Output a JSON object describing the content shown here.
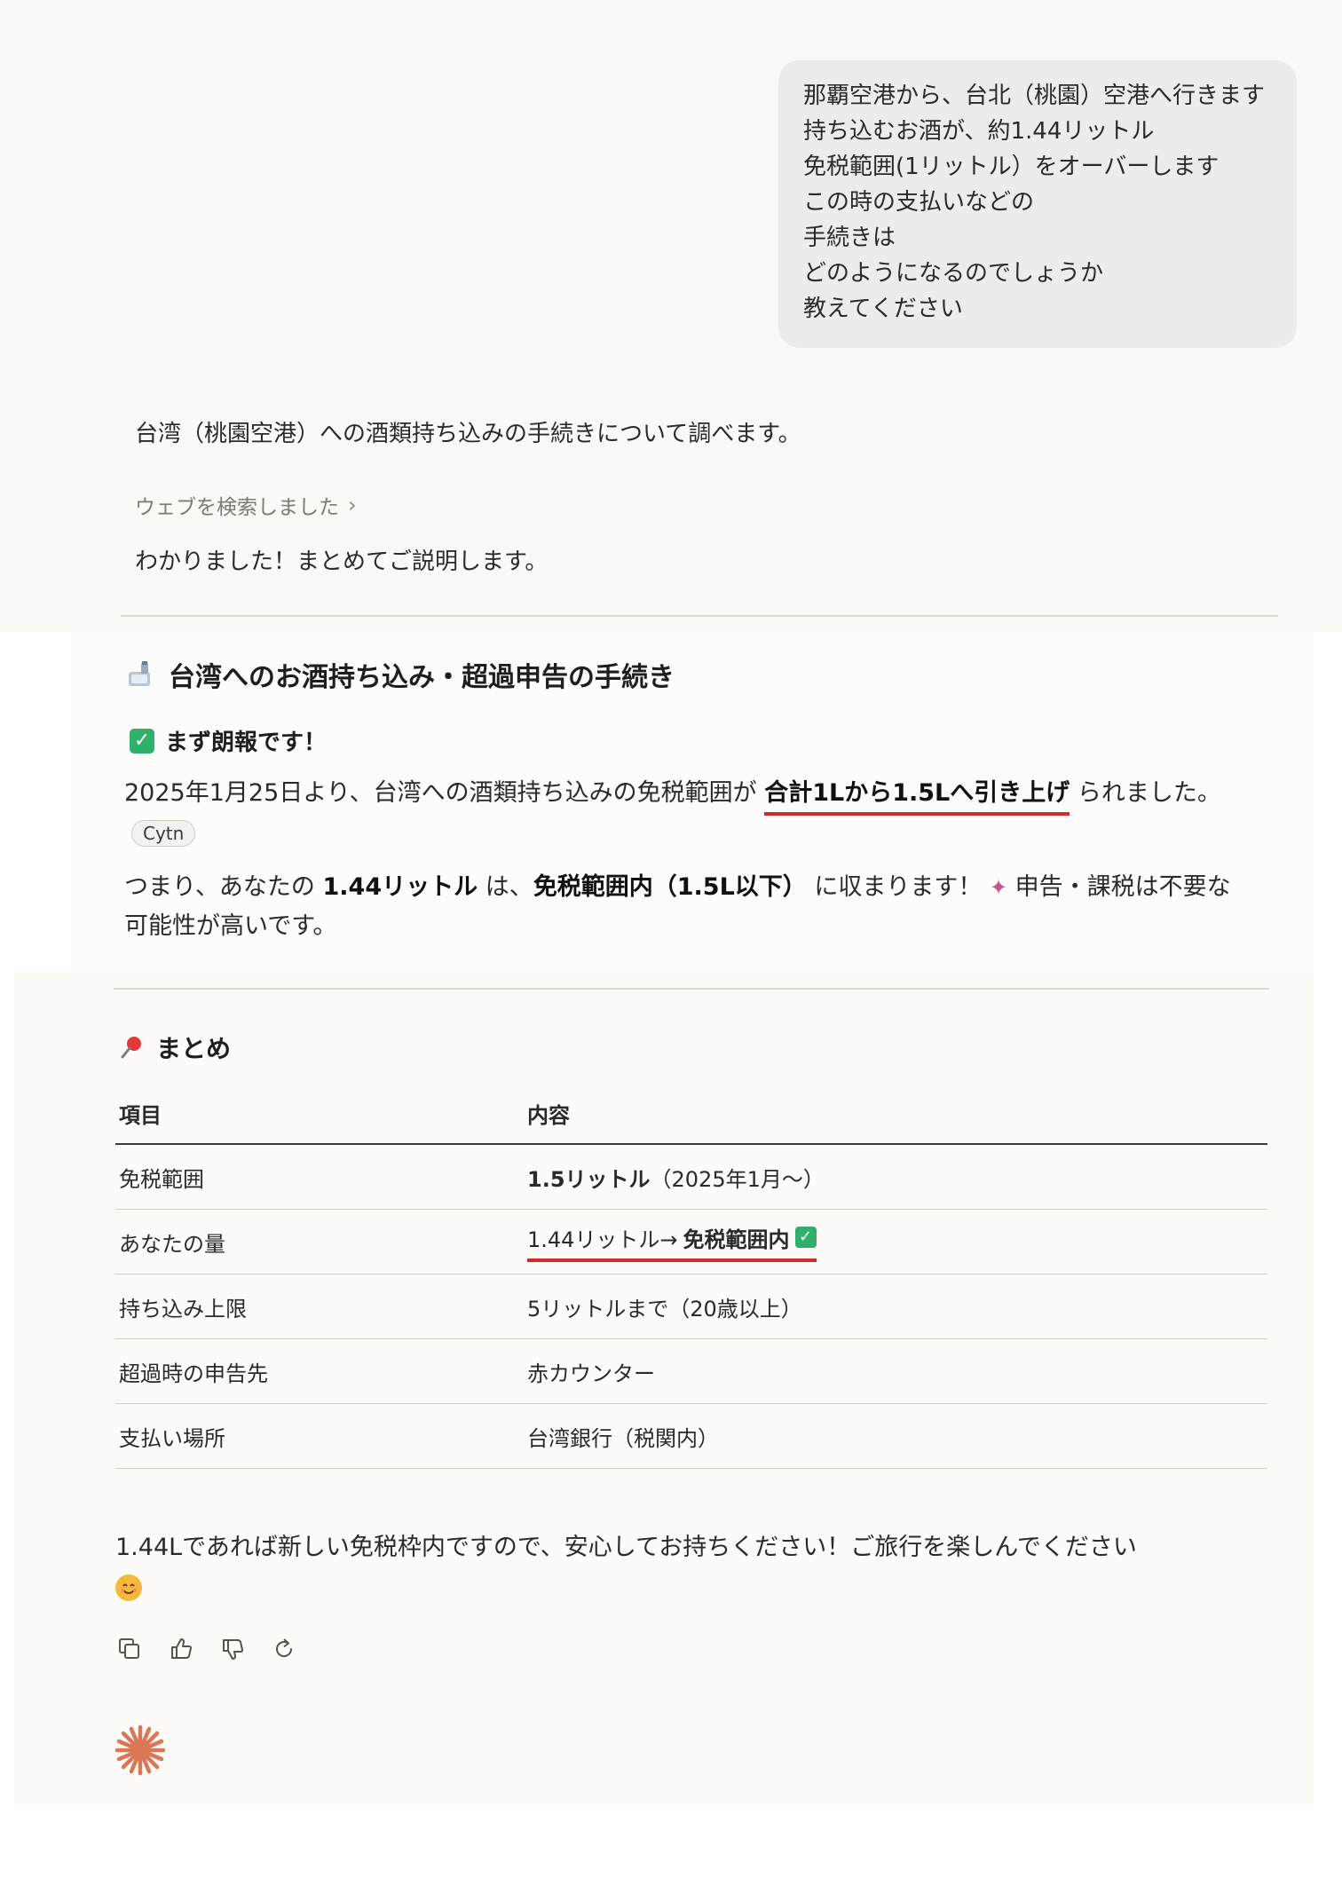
{
  "user_message": {
    "lines": [
      "那覇空港から、台北（桃園）空港へ行きます",
      "持ち込むお酒が、約1.44リットル",
      "免税範囲(1リットル）をオーバーします",
      "この時の支払いなどの",
      "手続きは",
      "どのようになるのでしょうか",
      "教えてください"
    ]
  },
  "assistant": {
    "intro": "台湾（桃園空港）への酒類持ち込みの手続きについて調べます。",
    "web_search_label": "ウェブを検索しました",
    "ack": "わかりました！まとめてご説明します。",
    "section_title": "台湾へのお酒持ち込み・超過申告の手続き",
    "good_news_title": "まず朗報です！",
    "para1": {
      "pre": "2025年1月25日より、台湾への酒類持ち込みの免税範囲が ",
      "bold": "合計1Lから1.5Lへ引き上げ",
      "post": " られました。",
      "citation": "Cytn"
    },
    "para2": {
      "pre": "つまり、あなたの ",
      "bold1": "1.44リットル",
      "mid": " は、",
      "bold2": "免税範囲内（1.5L以下）",
      "mid2": " に収まります！",
      "post": " 申告・課税は不要な可能性が高いです。"
    },
    "summary_title": "まとめ",
    "table": {
      "headers": [
        "項目",
        "内容"
      ],
      "rows": [
        {
          "label": "免税範囲",
          "bold": "1.5リットル",
          "rest": "（2025年1月〜）"
        },
        {
          "label": "あなたの量",
          "rest_pre": "1.44リットル→ ",
          "bold": "免税範囲内"
        },
        {
          "label": "持ち込み上限",
          "rest": "5リットルまで（20歳以上）"
        },
        {
          "label": "超過時の申告先",
          "rest": "赤カウンター"
        },
        {
          "label": "支払い場所",
          "rest": "台湾銀行（税関内）"
        }
      ]
    },
    "closing": "1.44Lであれば新しい免税枠内ですので、安心してお持ちください！ご旅行を楽しんでください",
    "icons": {
      "section": "sake-bottle-icon",
      "check": "check-box-icon",
      "party": "party-popper-icon",
      "pin": "pushpin-icon",
      "smile": "smiling-face-icon",
      "brand": "claude-spark-icon"
    },
    "colors": {
      "accent_underline": "#d22b2b",
      "check_green": "#2fb06b",
      "brand_orange": "#d97757"
    }
  }
}
